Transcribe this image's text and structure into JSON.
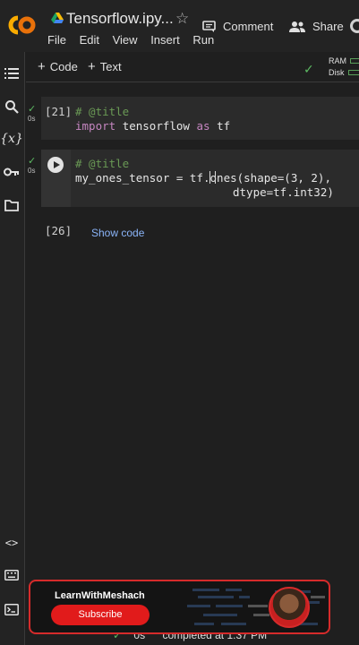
{
  "header": {
    "title": "Tensorflow.ipy...",
    "menu": [
      "File",
      "Edit",
      "View",
      "Insert",
      "Run"
    ],
    "comment_label": "Comment",
    "share_label": "Share"
  },
  "toolbar": {
    "add_code_label": "Code",
    "add_text_label": "Text",
    "ram_label": "RAM",
    "disk_label": "Disk"
  },
  "cells": [
    {
      "exec_count": "[21]",
      "exec_time": "0s",
      "line1_comment": "# @title",
      "line2_kw": "import",
      "line2_mod": "tensorflow",
      "line2_as": "as",
      "line2_alias": "tf"
    },
    {
      "exec_time": "0s",
      "line1_comment": "# @title",
      "line2": "my_ones_tensor = tf.ones(shape=(3, 2),",
      "line3": "dtype=tf.int32)"
    },
    {
      "exec_count": "[26]",
      "show_code_label": "Show code"
    }
  ],
  "status": {
    "time": "0s",
    "text": "completed at 1:37 PM"
  },
  "promo": {
    "channel_name": "LearnWithMeshach",
    "subscribe_label": "Subscribe"
  },
  "colors": {
    "accent_green": "#5dbb63",
    "link_blue": "#8ab4f8",
    "promo_red": "#e11b1b"
  }
}
